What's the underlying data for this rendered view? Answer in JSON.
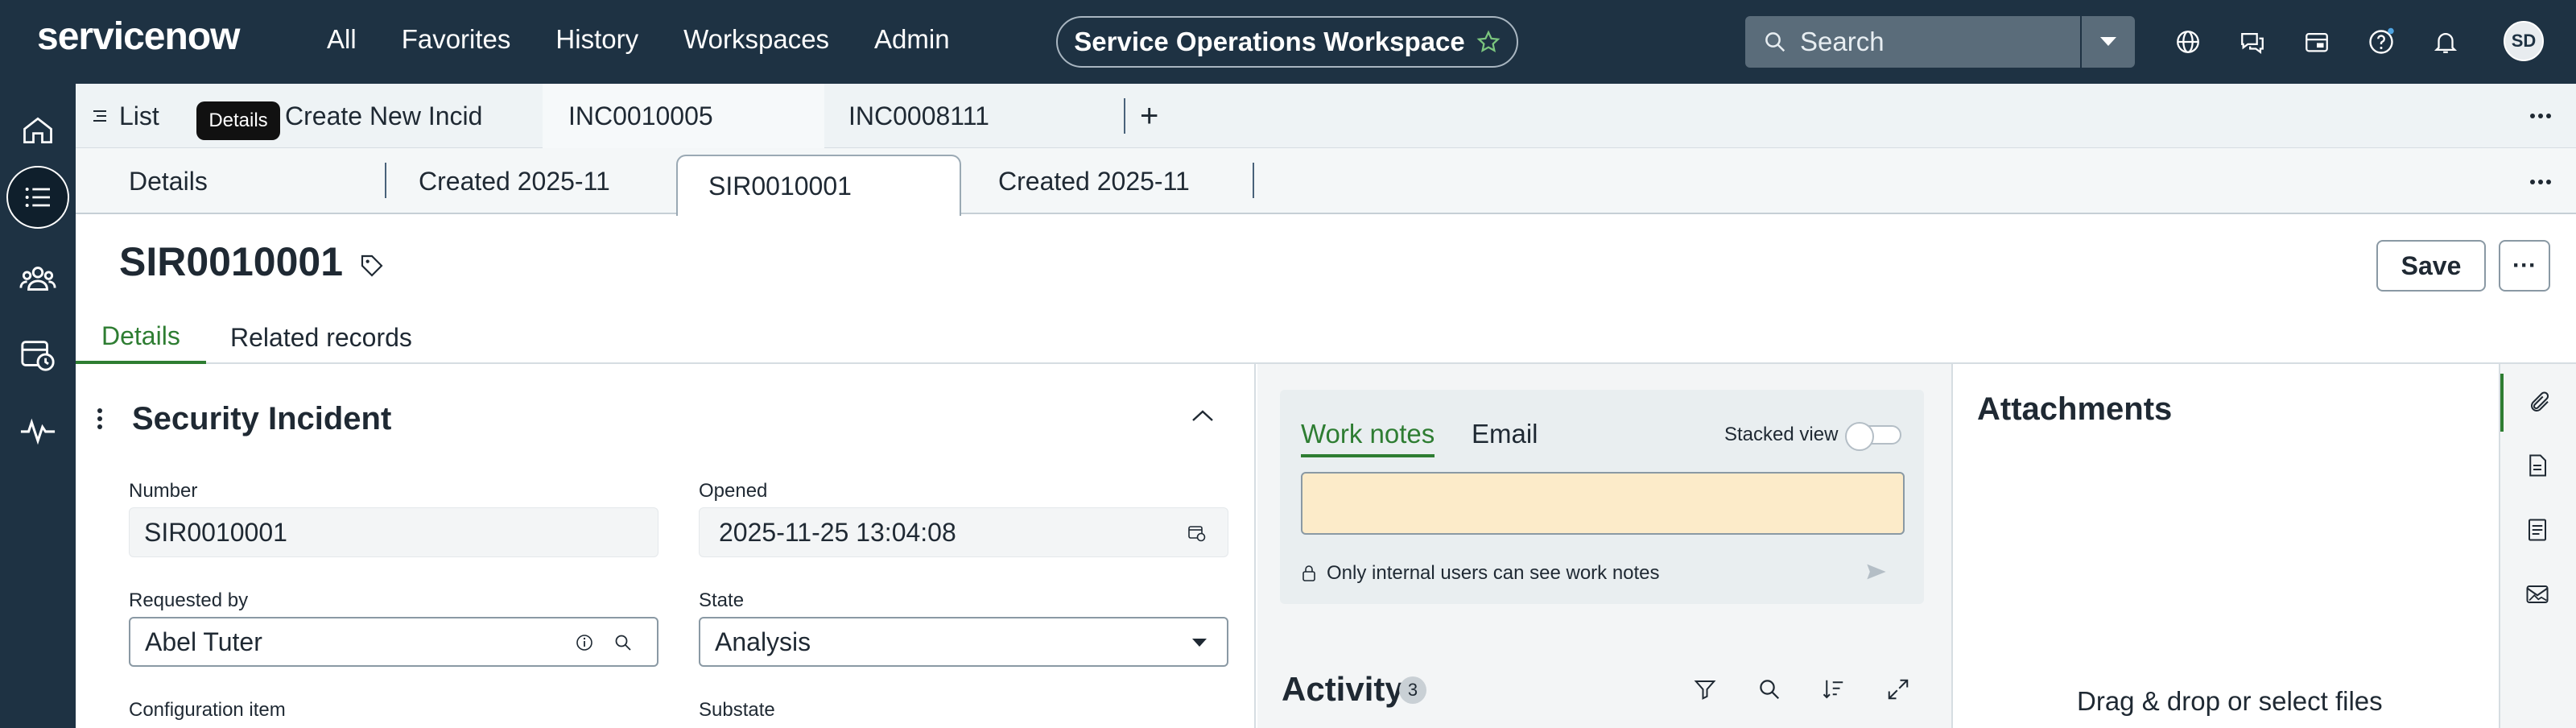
{
  "topbar": {
    "logo": "servicenow",
    "nav": [
      "All",
      "Favorites",
      "History",
      "Workspaces",
      "Admin"
    ],
    "workspace": "Service Operations Workspace",
    "search_placeholder": "Search",
    "avatar_initials": "SD"
  },
  "workspace_tabs": {
    "list_label": "List",
    "tooltip": "Details",
    "tabs": [
      "Create New Incid",
      "INC0010005",
      "INC0008111"
    ],
    "add_label": "+"
  },
  "sub_tabs": {
    "tabs": [
      "Details",
      "Created 2025-11",
      "SIR0010001",
      "Created 2025-11"
    ]
  },
  "record": {
    "title": "SIR0010001",
    "save_label": "Save",
    "more_label": "···",
    "tabs": [
      "Details",
      "Related records"
    ]
  },
  "form": {
    "section_title": "Security Incident",
    "fields": {
      "number_label": "Number",
      "number_value": "SIR0010001",
      "opened_label": "Opened",
      "opened_value": "2025-11-25 13:04:08",
      "requested_by_label": "Requested by",
      "requested_by_value": "Abel Tuter",
      "state_label": "State",
      "state_value": "Analysis",
      "ci_label": "Configuration item",
      "substate_label": "Substate"
    }
  },
  "activity": {
    "work_notes_tab": "Work notes",
    "email_tab": "Email",
    "stacked_view_label": "Stacked view",
    "internal_note": "Only internal users can see work notes",
    "title": "Activity",
    "count": "3"
  },
  "attachments": {
    "title": "Attachments",
    "drop_text": "Drag & drop or select files"
  },
  "colors": {
    "nav_bg": "#1e3243",
    "accent_green": "#2e7d32",
    "work_notes_bg": "#fcebc9"
  }
}
